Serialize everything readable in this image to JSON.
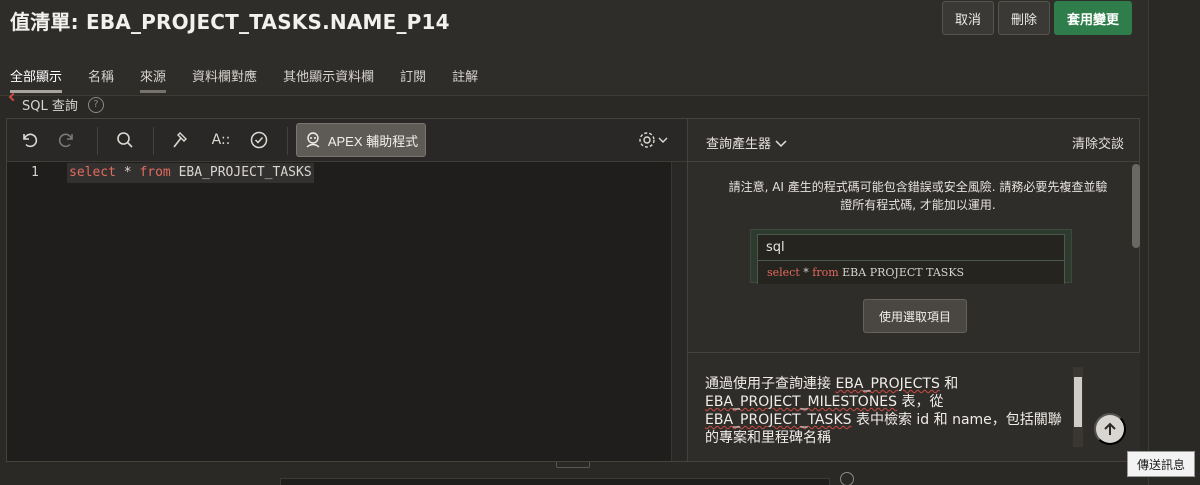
{
  "header": {
    "title": "值清單: EBA_PROJECT_TASKS.NAME_P14",
    "cancel_label": "取消",
    "delete_label": "刪除",
    "apply_label": "套用變更",
    "apply_color": "#2f7d4a"
  },
  "tabs": [
    {
      "label": "全部顯示",
      "active": true
    },
    {
      "label": "名稱",
      "active": false
    },
    {
      "label": "來源",
      "active": false
    },
    {
      "label": "資料欄對應",
      "active": false
    },
    {
      "label": "其他顯示資料欄",
      "active": false
    },
    {
      "label": "訂閱",
      "active": false
    },
    {
      "label": "註解",
      "active": false
    }
  ],
  "sql_field": {
    "label": "SQL 查詢",
    "help_icon": "question-circle-icon"
  },
  "toolbar": {
    "undo_icon": "undo-icon",
    "redo_icon": "redo-icon",
    "search_icon": "search-icon",
    "hammer_icon": "hammer-icon",
    "text_icon": "text-format-icon",
    "validate_icon": "check-circle-icon",
    "apex_label": "APEX 輔助程式",
    "settings_icon": "gear-icon"
  },
  "editor": {
    "line_number": "1",
    "code_kw1": "select",
    "code_mid": " * ",
    "code_kw2": "from",
    "code_rest": " EBA_PROJECT_TASKS"
  },
  "assistant": {
    "query_builder_label": "查詢產生器",
    "clear_label": "清除交談",
    "warning": "請注意, AI 產生的程式碼可能包含錯誤或安全風險. 請務必要先複查並驗證所有程式碼, 才能加以運用.",
    "card_title": "sql",
    "card_code_kw1": "select",
    "card_code_mid": " * ",
    "card_code_kw2": "from",
    "card_code_rest": " EBA PROJECT TASKS",
    "use_selection_label": "使用選取項目",
    "prompt_part1": "通過使用子查詢連接 ",
    "prompt_sq1": "EBA_PROJECTS",
    "prompt_part2": " 和 ",
    "prompt_sq2": "EBA_PROJECT_MILESTONES",
    "prompt_part3": " 表，從 ",
    "prompt_sq3": "EBA_PROJECT_TASKS",
    "prompt_part4": " 表中檢索 id 和 name，包括關聯的專案和里程碑名稱"
  },
  "tooltip": "傳送訊息"
}
